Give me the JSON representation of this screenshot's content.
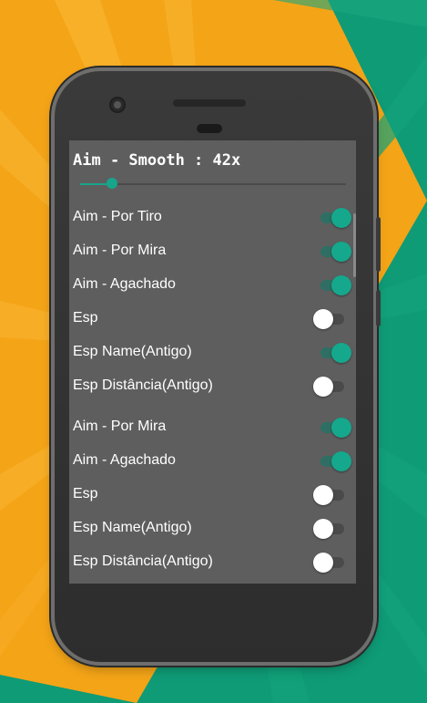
{
  "colors": {
    "accent": "#17a58b",
    "screen_bg": "#5e5e5e",
    "background_orange": "#f4a417",
    "background_green": "#0f9b76"
  },
  "menu": {
    "smooth_label": "Aim - Smooth : 42x",
    "smooth_value_fraction": 0.12,
    "options": [
      {
        "label": "Aim - Por Tiro",
        "on": true
      },
      {
        "label": "Aim - Por Mira",
        "on": true
      },
      {
        "label": "Aim - Agachado",
        "on": true
      },
      {
        "label": "Esp",
        "on": false
      },
      {
        "label": "Esp Name(Antigo)",
        "on": true
      },
      {
        "label": "Esp Distância(Antigo)",
        "on": false
      },
      {
        "label": "Aim - Por Mira",
        "on": true
      },
      {
        "label": "Aim - Agachado",
        "on": true
      },
      {
        "label": "Esp",
        "on": false
      },
      {
        "label": "Esp Name(Antigo)",
        "on": false
      },
      {
        "label": "Esp Distância(Antigo)",
        "on": false
      }
    ]
  }
}
